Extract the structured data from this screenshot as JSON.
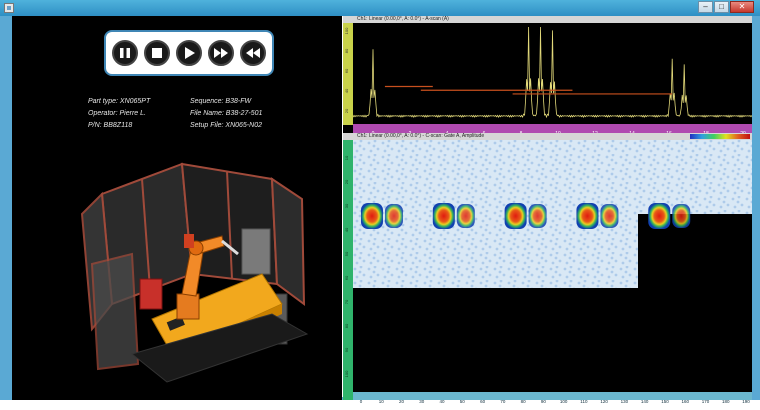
{
  "window": {
    "minimize_glyph": "–",
    "maximize_glyph": "□",
    "close_glyph": "✕"
  },
  "controls": [
    {
      "name": "pause-button",
      "icon": "pause-icon"
    },
    {
      "name": "stop-button",
      "icon": "stop-icon"
    },
    {
      "name": "play-button",
      "icon": "play-icon"
    },
    {
      "name": "fast-forward-button",
      "icon": "fast-forward-icon"
    },
    {
      "name": "rewind-button",
      "icon": "rewind-icon"
    }
  ],
  "part_info": {
    "part_type": "Part type: XN065PT",
    "operator": "Operator: Pierre L.",
    "pn": "P/N: BB8Z118",
    "sequence": "Sequence: B38-FW",
    "file_name": "File Name: B38-27-501",
    "setup_file": "Setup File: XN065-N02"
  },
  "ascan": {
    "header": "Ch1: Linear (0.00,0°, A: 0.0°) - A-scan (A)",
    "y_ticks": [
      "100",
      "80",
      "60",
      "40",
      "20"
    ],
    "x_ticks": [
      "0",
      "2",
      "4",
      "6",
      "8",
      "10",
      "12",
      "14",
      "16",
      "18",
      "20"
    ],
    "peaks": [
      {
        "x": 0.05,
        "amplitude": 0.72
      },
      {
        "x": 0.44,
        "amplitude": 1.0
      },
      {
        "x": 0.47,
        "amplitude": 1.0
      },
      {
        "x": 0.5,
        "amplitude": 0.92
      },
      {
        "x": 0.8,
        "amplitude": 0.62
      },
      {
        "x": 0.83,
        "amplitude": 0.55
      }
    ],
    "gates": [
      {
        "x0": 0.08,
        "x1": 0.2,
        "level": 0.36
      },
      {
        "x0": 0.17,
        "x1": 0.55,
        "level": 0.32
      },
      {
        "x0": 0.4,
        "x1": 0.8,
        "level": 0.28
      }
    ]
  },
  "cscan": {
    "header": "Ch1: Linear (0.00,0°, A: 0.0°) - C-scan: Gate A, Amplitude",
    "x_ticks": [
      "0",
      "10",
      "20",
      "30",
      "40",
      "50",
      "60",
      "70",
      "80",
      "90",
      "100",
      "110",
      "120",
      "130",
      "140",
      "150",
      "160",
      "170",
      "180",
      "190"
    ],
    "y_ticks": [
      "10",
      "20",
      "30",
      "40",
      "50",
      "60",
      "70",
      "80",
      "90",
      "100"
    ],
    "defect_pairs": [
      {
        "x": 0.02
      },
      {
        "x": 0.2
      },
      {
        "x": 0.38
      },
      {
        "x": 0.56
      },
      {
        "x": 0.74
      }
    ]
  },
  "colors": {
    "frame": "#5aa9d4",
    "accent": "#3f86b5",
    "ascan_signal": "#e2d97a",
    "gate": "#c8501e",
    "cscan_bg": "#d9e8f5"
  }
}
